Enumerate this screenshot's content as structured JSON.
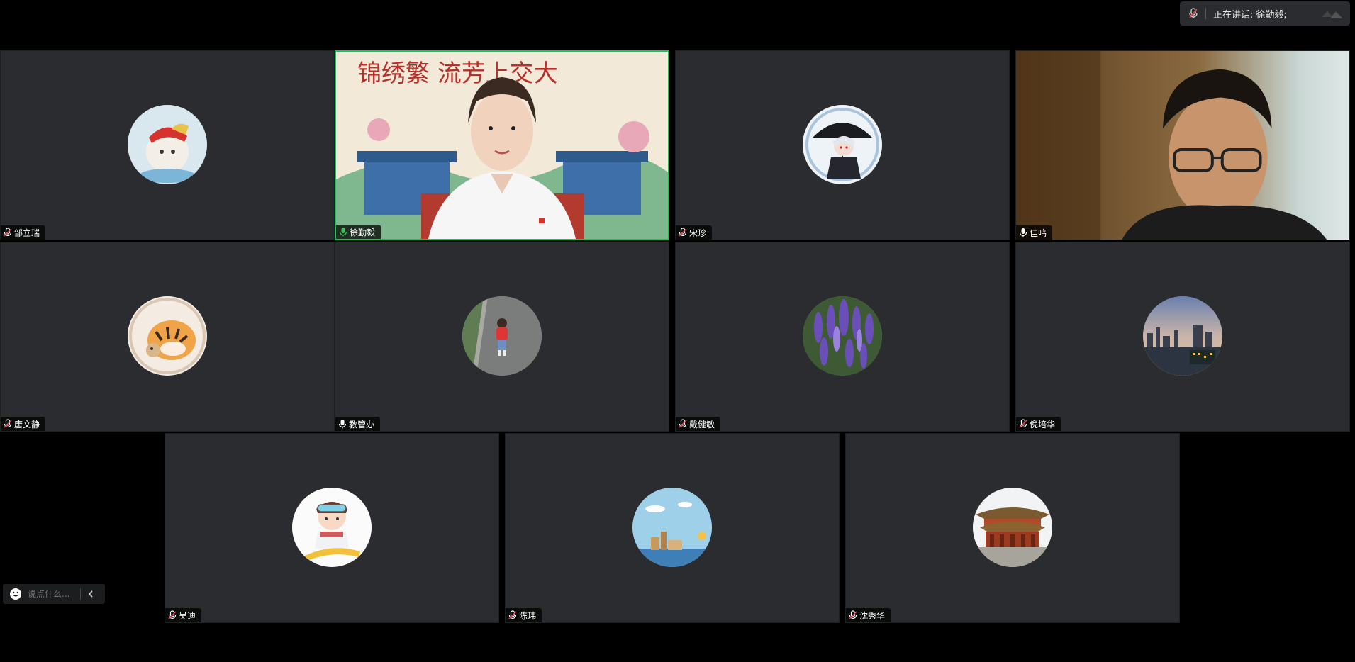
{
  "speaking": {
    "label": "正在讲话:",
    "names": "徐勤毅;"
  },
  "participants": [
    {
      "name": "邹立瑞",
      "mic": "muted",
      "kind": "avatar",
      "avatar_icon": "hamster-hat-avatar"
    },
    {
      "name": "徐勤毅",
      "mic": "active",
      "kind": "video",
      "video_icon": "presenter-video"
    },
    {
      "name": "宋珍",
      "mic": "muted",
      "kind": "avatar",
      "avatar_icon": "anime-umbrella-avatar"
    },
    {
      "name": "佳鸣",
      "mic": "on",
      "kind": "video",
      "video_icon": "man-glasses-video"
    },
    {
      "name": "唐文静",
      "mic": "muted",
      "kind": "avatar",
      "avatar_icon": "tiger-avatar"
    },
    {
      "name": "教管办",
      "mic": "on",
      "kind": "avatar",
      "avatar_icon": "child-road-avatar"
    },
    {
      "name": "戴健敏",
      "mic": "muted",
      "kind": "avatar",
      "avatar_icon": "lavender-avatar"
    },
    {
      "name": "倪培华",
      "mic": "muted",
      "kind": "avatar",
      "avatar_icon": "city-skyline-avatar"
    },
    {
      "name": "吴迪",
      "mic": "muted",
      "kind": "avatar",
      "avatar_icon": "snowboard-kid-avatar"
    },
    {
      "name": "陈玮",
      "mic": "muted",
      "kind": "avatar",
      "avatar_icon": "sea-scene-avatar"
    },
    {
      "name": "沈秀华",
      "mic": "muted",
      "kind": "avatar",
      "avatar_icon": "palace-avatar"
    }
  ],
  "chat": {
    "placeholder": "说点什么..."
  },
  "colors": {
    "tile_bg": "#2a2c2f",
    "active_border": "#1fbf5b",
    "mic_on": "#3ec15a",
    "mic_muted": "#e14545"
  }
}
